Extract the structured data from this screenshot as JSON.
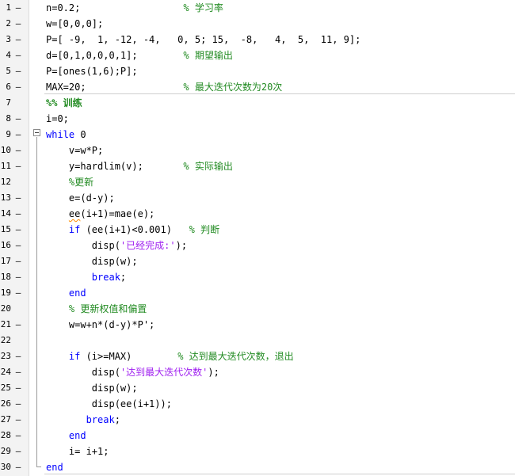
{
  "editor": {
    "lines": [
      {
        "n": "1",
        "dash": "–",
        "parts": [
          {
            "t": "n=0.2;                  "
          },
          {
            "t": "% 学习率",
            "c": "cm"
          }
        ]
      },
      {
        "n": "2",
        "dash": "–",
        "parts": [
          {
            "t": "w=[0,0,0];"
          }
        ]
      },
      {
        "n": "3",
        "dash": "–",
        "parts": [
          {
            "t": "P=[ -9,  1, -12, -4,   0, 5; 15,  -8,   4,  5,  11, 9];"
          }
        ]
      },
      {
        "n": "4",
        "dash": "–",
        "parts": [
          {
            "t": "d=[0,1,0,0,0,1];        "
          },
          {
            "t": "% 期望输出",
            "c": "cm"
          }
        ]
      },
      {
        "n": "5",
        "dash": "–",
        "parts": [
          {
            "t": "P=[ones(1,6);P];"
          }
        ]
      },
      {
        "n": "6",
        "dash": "–",
        "parts": [
          {
            "t": "MAX=20;                 "
          },
          {
            "t": "% 最大迭代次数为20次",
            "c": "cm"
          }
        ]
      },
      {
        "n": "7",
        "dash": "",
        "parts": [
          {
            "t": "%% 训练",
            "c": "cell"
          }
        ]
      },
      {
        "n": "8",
        "dash": "–",
        "parts": [
          {
            "t": "i=0;"
          }
        ]
      },
      {
        "n": "9",
        "dash": "–",
        "parts": [
          {
            "t": "while",
            "c": "kw"
          },
          {
            "t": " 0"
          }
        ]
      },
      {
        "n": "10",
        "dash": "–",
        "parts": [
          {
            "t": "    v=w*P;"
          }
        ]
      },
      {
        "n": "11",
        "dash": "–",
        "parts": [
          {
            "t": "    y=hardlim(v);       "
          },
          {
            "t": "% 实际输出",
            "c": "cm"
          }
        ]
      },
      {
        "n": "12",
        "dash": "",
        "parts": [
          {
            "t": "    "
          },
          {
            "t": "%更新",
            "c": "cm"
          }
        ]
      },
      {
        "n": "13",
        "dash": "–",
        "parts": [
          {
            "t": "    e=(d-y);"
          }
        ]
      },
      {
        "n": "14",
        "dash": "–",
        "parts": [
          {
            "t": "    "
          },
          {
            "t": "ee",
            "c": "squiggle"
          },
          {
            "t": "(i+1)=mae(e);"
          }
        ]
      },
      {
        "n": "15",
        "dash": "–",
        "parts": [
          {
            "t": "    "
          },
          {
            "t": "if",
            "c": "kw"
          },
          {
            "t": " (ee(i+1)<0.001)   "
          },
          {
            "t": "% 判断",
            "c": "cm"
          }
        ]
      },
      {
        "n": "16",
        "dash": "–",
        "parts": [
          {
            "t": "        disp("
          },
          {
            "t": "'已经完成:'",
            "c": "str"
          },
          {
            "t": ");"
          }
        ]
      },
      {
        "n": "17",
        "dash": "–",
        "parts": [
          {
            "t": "        disp(w);"
          }
        ]
      },
      {
        "n": "18",
        "dash": "–",
        "parts": [
          {
            "t": "        "
          },
          {
            "t": "break",
            "c": "kw"
          },
          {
            "t": ";"
          }
        ]
      },
      {
        "n": "19",
        "dash": "–",
        "parts": [
          {
            "t": "    "
          },
          {
            "t": "end",
            "c": "kw"
          }
        ]
      },
      {
        "n": "20",
        "dash": "",
        "parts": [
          {
            "t": "    "
          },
          {
            "t": "% 更新权值和偏置",
            "c": "cm"
          }
        ]
      },
      {
        "n": "21",
        "dash": "–",
        "parts": [
          {
            "t": "    w=w+n*(d-y)*P';"
          }
        ]
      },
      {
        "n": "22",
        "dash": "",
        "parts": [
          {
            "t": ""
          }
        ]
      },
      {
        "n": "23",
        "dash": "–",
        "parts": [
          {
            "t": "    "
          },
          {
            "t": "if",
            "c": "kw"
          },
          {
            "t": " (i>=MAX)        "
          },
          {
            "t": "% 达到最大迭代次数，退出",
            "c": "cm"
          }
        ]
      },
      {
        "n": "24",
        "dash": "–",
        "parts": [
          {
            "t": "        disp("
          },
          {
            "t": "'达到最大迭代次数'",
            "c": "str"
          },
          {
            "t": ");"
          }
        ]
      },
      {
        "n": "25",
        "dash": "–",
        "parts": [
          {
            "t": "        disp(w);"
          }
        ]
      },
      {
        "n": "26",
        "dash": "–",
        "parts": [
          {
            "t": "        disp(ee(i+1));"
          }
        ]
      },
      {
        "n": "27",
        "dash": "–",
        "parts": [
          {
            "t": "       "
          },
          {
            "t": "break",
            "c": "kw"
          },
          {
            "t": ";"
          }
        ]
      },
      {
        "n": "28",
        "dash": "–",
        "parts": [
          {
            "t": "    "
          },
          {
            "t": "end",
            "c": "kw"
          }
        ]
      },
      {
        "n": "29",
        "dash": "–",
        "parts": [
          {
            "t": "    i= i+1;"
          }
        ]
      },
      {
        "n": "30",
        "dash": "–",
        "parts": [
          {
            "t": "end",
            "c": "kw"
          }
        ]
      }
    ]
  },
  "colors": {
    "keyword": "#0000ff",
    "comment": "#228b22",
    "string": "#a020f0",
    "warning_underline": "#ff8c00"
  }
}
